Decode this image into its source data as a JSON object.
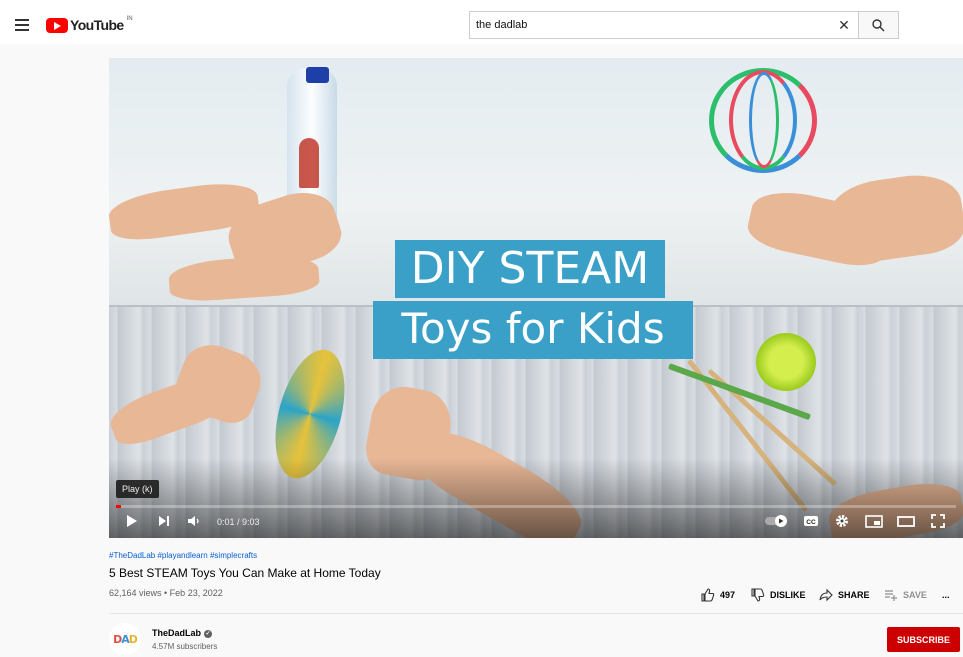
{
  "masthead": {
    "logo_text": "YouTube",
    "country_code": "IN",
    "search_value": "the dadlab",
    "search_placeholder": "Search"
  },
  "player": {
    "overlay_title_line1": "DIY STEAM",
    "overlay_title_line2": "Toys for Kids",
    "tooltip": "Play (k)",
    "time_display": "0:01 / 9:03",
    "progress_fraction": 0.002,
    "controls": [
      "play-icon",
      "next-icon",
      "volume-icon",
      "autoplay-toggle-icon",
      "captions-icon",
      "settings-icon",
      "miniplayer-icon",
      "theater-icon",
      "fullscreen-icon"
    ],
    "captions_label": "CC"
  },
  "video": {
    "hashtags": "#TheDadLab #playandlearn #simplecrafts",
    "title": "5 Best STEAM Toys You Can Make at Home Today",
    "views_date": "62,164 views • Feb 23, 2022",
    "like_count": "497",
    "dislike_label": "DISLIKE",
    "share_label": "SHARE",
    "save_label": "SAVE",
    "more_label": "..."
  },
  "channel": {
    "name": "TheDadLab",
    "subscribers": "4.57M subscribers",
    "avatar_text": "DAD",
    "subscribe_label": "SUBSCRIBE"
  },
  "colors": {
    "brand_red": "#ff0000",
    "subscribe_red": "#cc0000",
    "link_blue": "#065fd4",
    "overlay_blue": "#3aa0c8"
  }
}
